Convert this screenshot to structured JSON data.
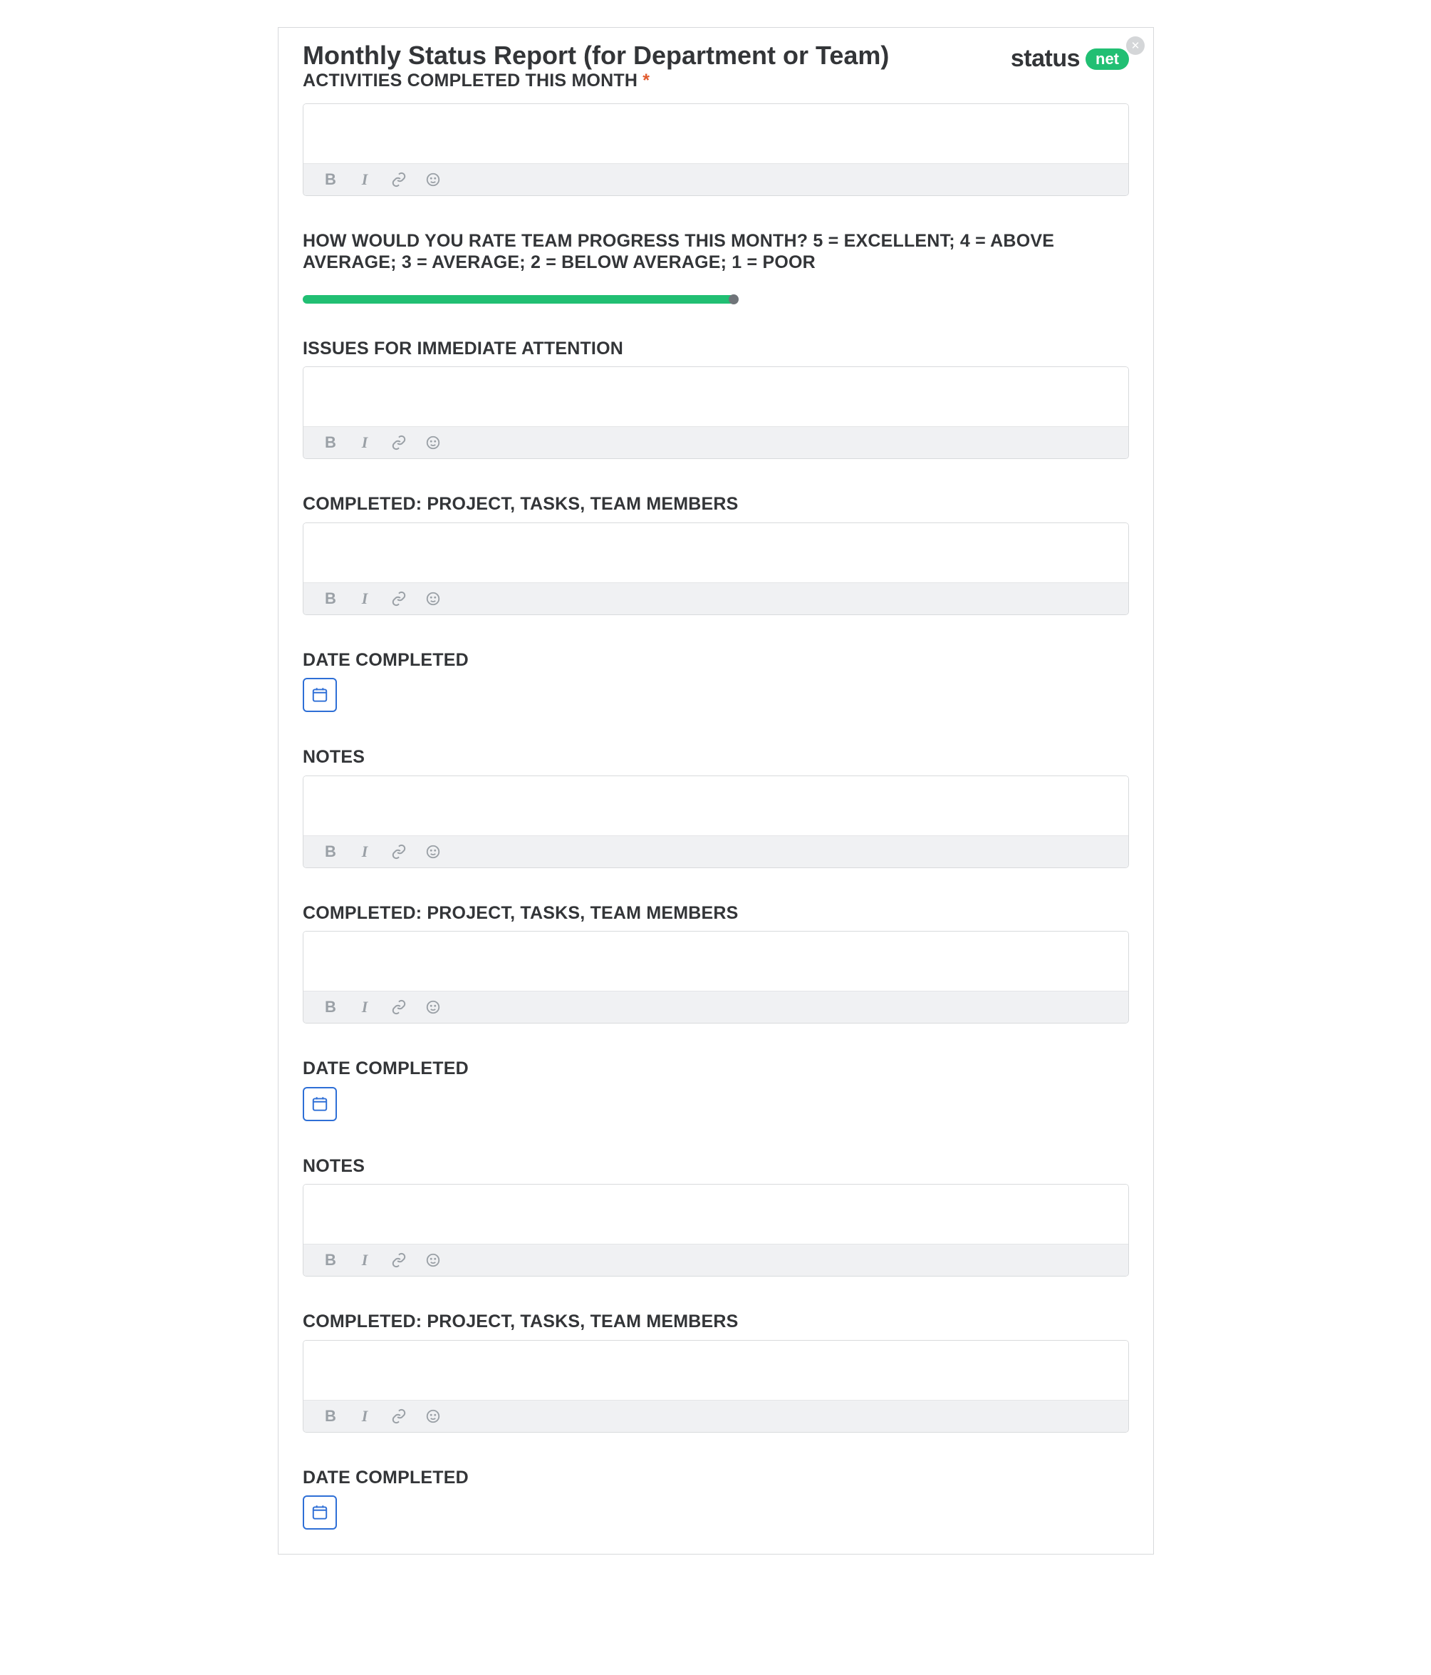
{
  "brand": {
    "word": "status",
    "pill": "net"
  },
  "close_label": "✕",
  "form": {
    "title": "Monthly Status Report (for Department or Team)",
    "sections": [
      {
        "label": "ACTIVITIES COMPLETED THIS MONTH",
        "required": true,
        "type": "rich"
      },
      {
        "label": "HOW WOULD YOU RATE TEAM PROGRESS THIS MONTH? 5 = EXCELLENT; 4 = ABOVE AVERAGE; 3 = AVERAGE; 2 = BELOW AVERAGE; 1 = POOR",
        "type": "slider"
      },
      {
        "label": "ISSUES FOR IMMEDIATE ATTENTION",
        "type": "rich"
      },
      {
        "label": "COMPLETED: PROJECT, TASKS, TEAM MEMBERS",
        "type": "rich"
      },
      {
        "label": "DATE COMPLETED",
        "type": "date"
      },
      {
        "label": "NOTES",
        "type": "rich"
      },
      {
        "label": "COMPLETED: PROJECT, TASKS, TEAM MEMBERS",
        "type": "rich"
      },
      {
        "label": "DATE COMPLETED",
        "type": "date"
      },
      {
        "label": "NOTES",
        "type": "rich"
      },
      {
        "label": "COMPLETED: PROJECT, TASKS, TEAM MEMBERS",
        "type": "rich"
      },
      {
        "label": "DATE COMPLETED",
        "type": "date"
      }
    ]
  },
  "toolbar": {
    "bold": "B",
    "italic": "I"
  },
  "required_star": "*"
}
